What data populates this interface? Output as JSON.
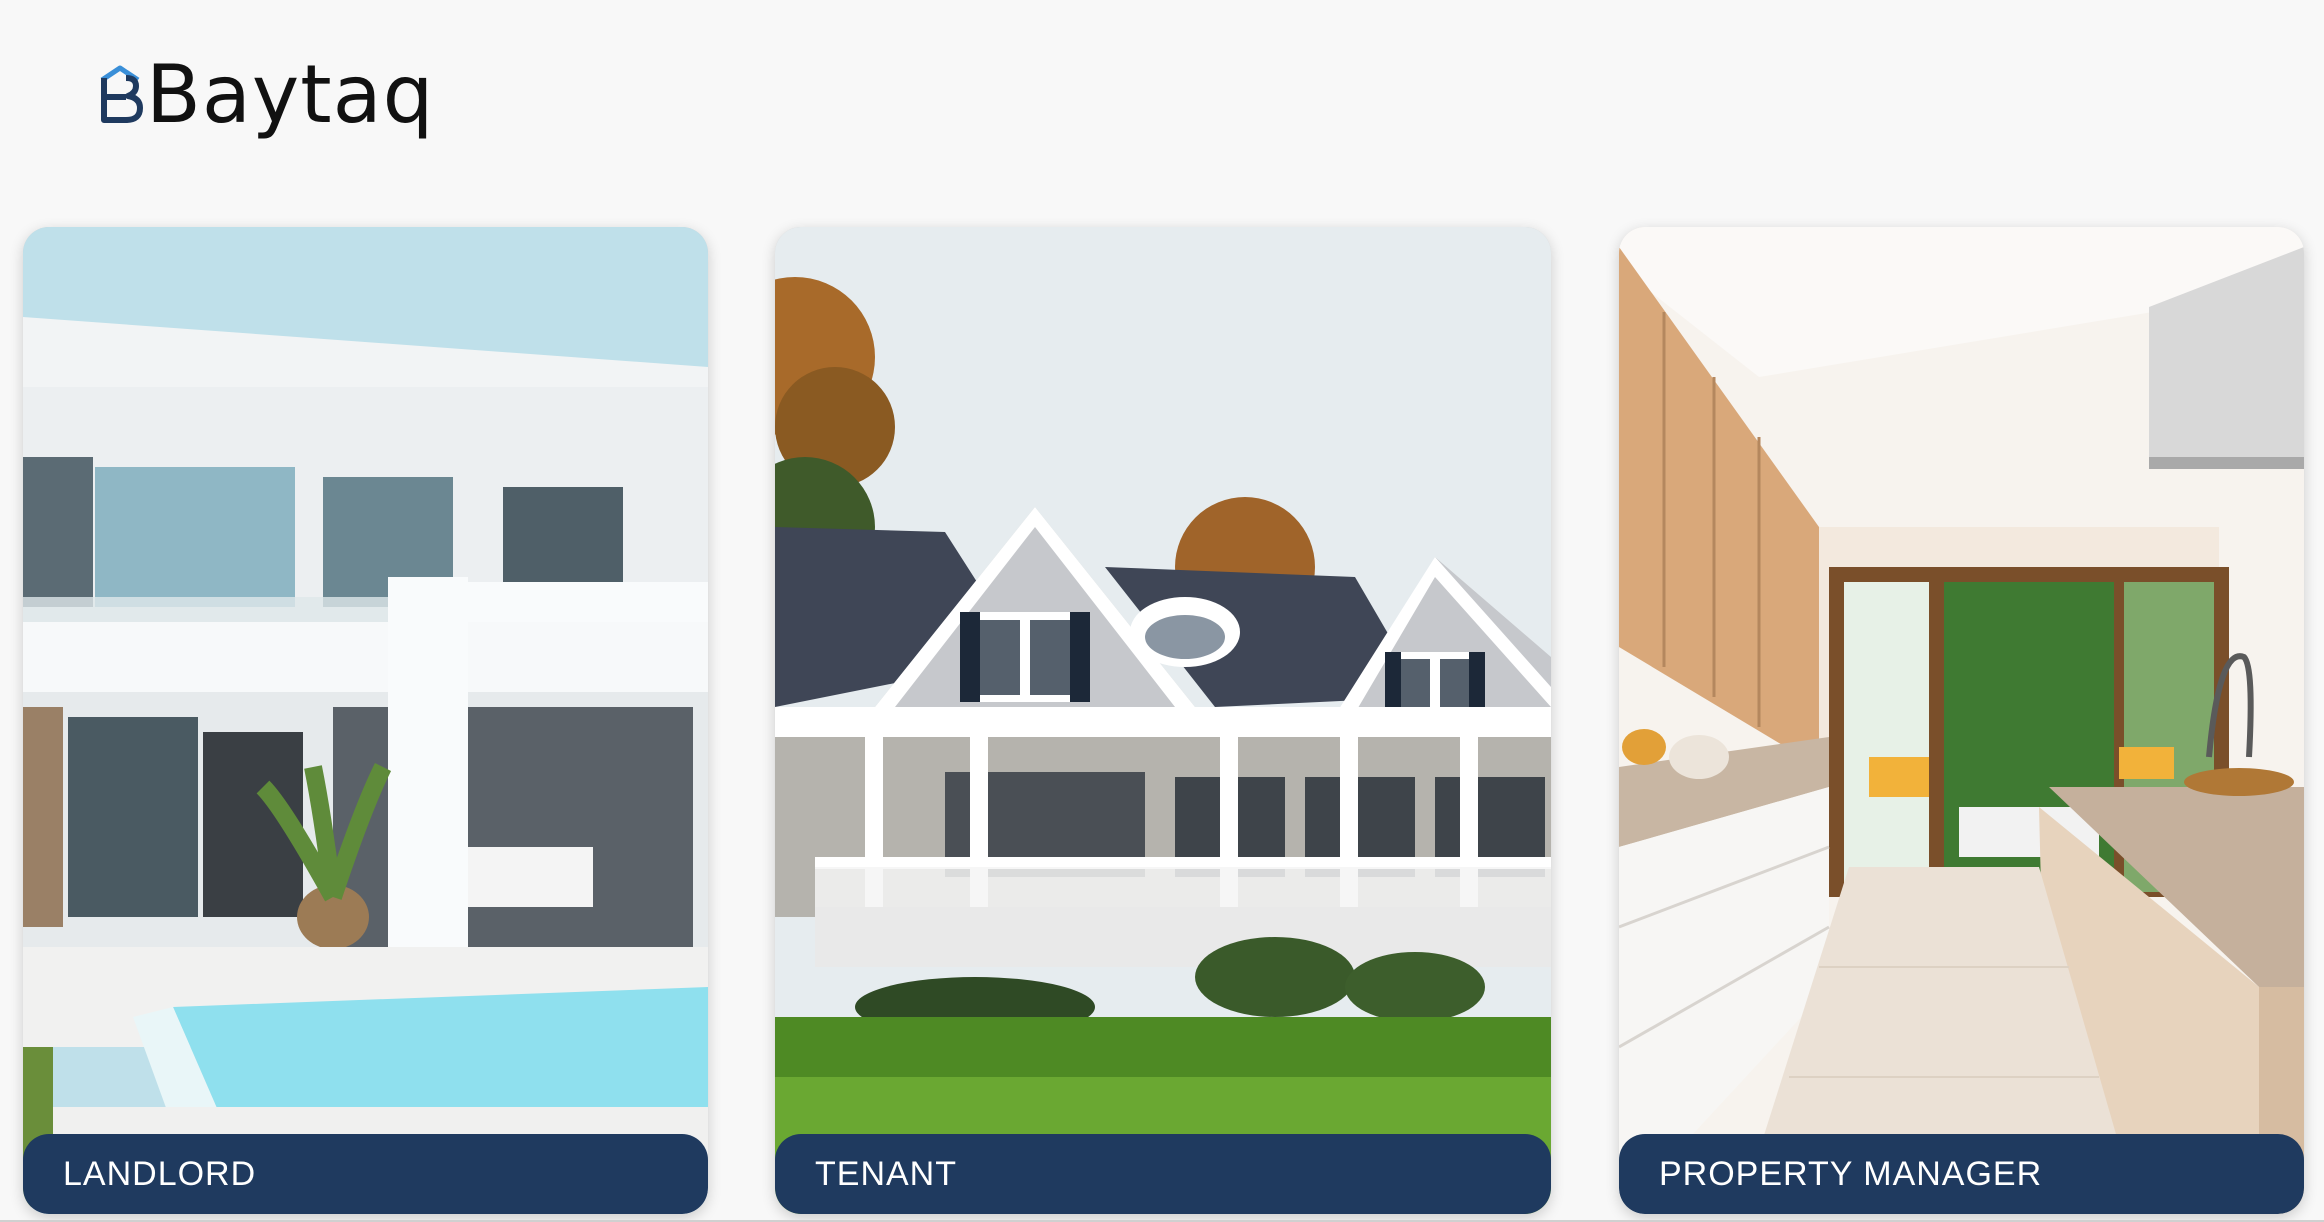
{
  "brand": {
    "name": "Baytaq"
  },
  "cards": [
    {
      "label": "LANDLORD"
    },
    {
      "label": "TENANT"
    },
    {
      "label": "PROPERTY MANAGER"
    }
  ],
  "colors": {
    "caption_bg": "#1f3a5f",
    "logo_blue": "#3a8fd8",
    "page_bg": "#f8f8f8"
  }
}
